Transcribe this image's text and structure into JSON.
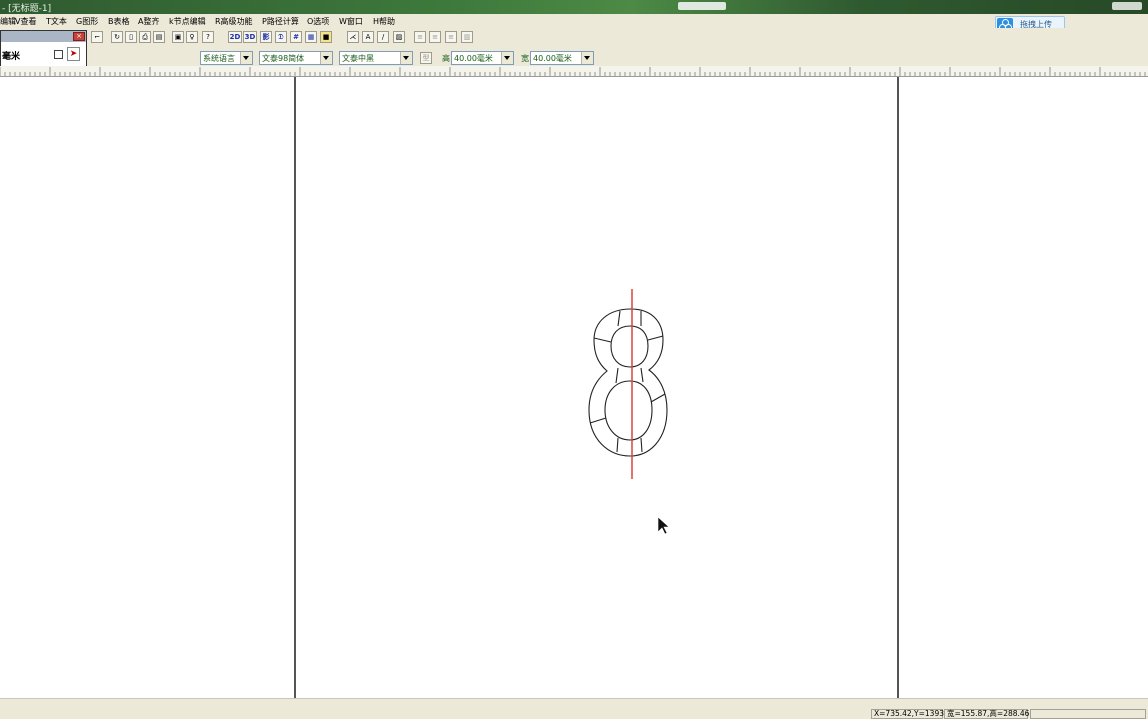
{
  "window": {
    "title": "- [无标题-1]"
  },
  "menu": {
    "items": [
      "编辑",
      "V查看",
      "T文本",
      "G图形",
      "B表格",
      "A整齐",
      "k节点编辑",
      "R高级功能",
      "P路径计算",
      "O选项",
      "W窗口",
      "H帮助"
    ]
  },
  "upload_button": {
    "label": "拖拽上传"
  },
  "panel": {
    "unit_text": "毫米"
  },
  "toolbar": {
    "buttons": [
      "2D",
      "3D"
    ],
    "language_select": "系统语言",
    "font_select": "文泰98简体",
    "font2_select": "文泰中黑",
    "height_label": "高",
    "height_value": "40.00毫米",
    "width_label": "宽",
    "width_value": "40.00毫米"
  },
  "canvas": {
    "glyph": "8",
    "accent_color": "#d9433b"
  },
  "status": {
    "coords": "X=735.42,Y=1393",
    "size": "宽=155.87,高=288.46"
  },
  "colors": {
    "titlebar": "#3e7a3c",
    "chrome": "#ece9d8",
    "guide_red": "#d9433b"
  }
}
